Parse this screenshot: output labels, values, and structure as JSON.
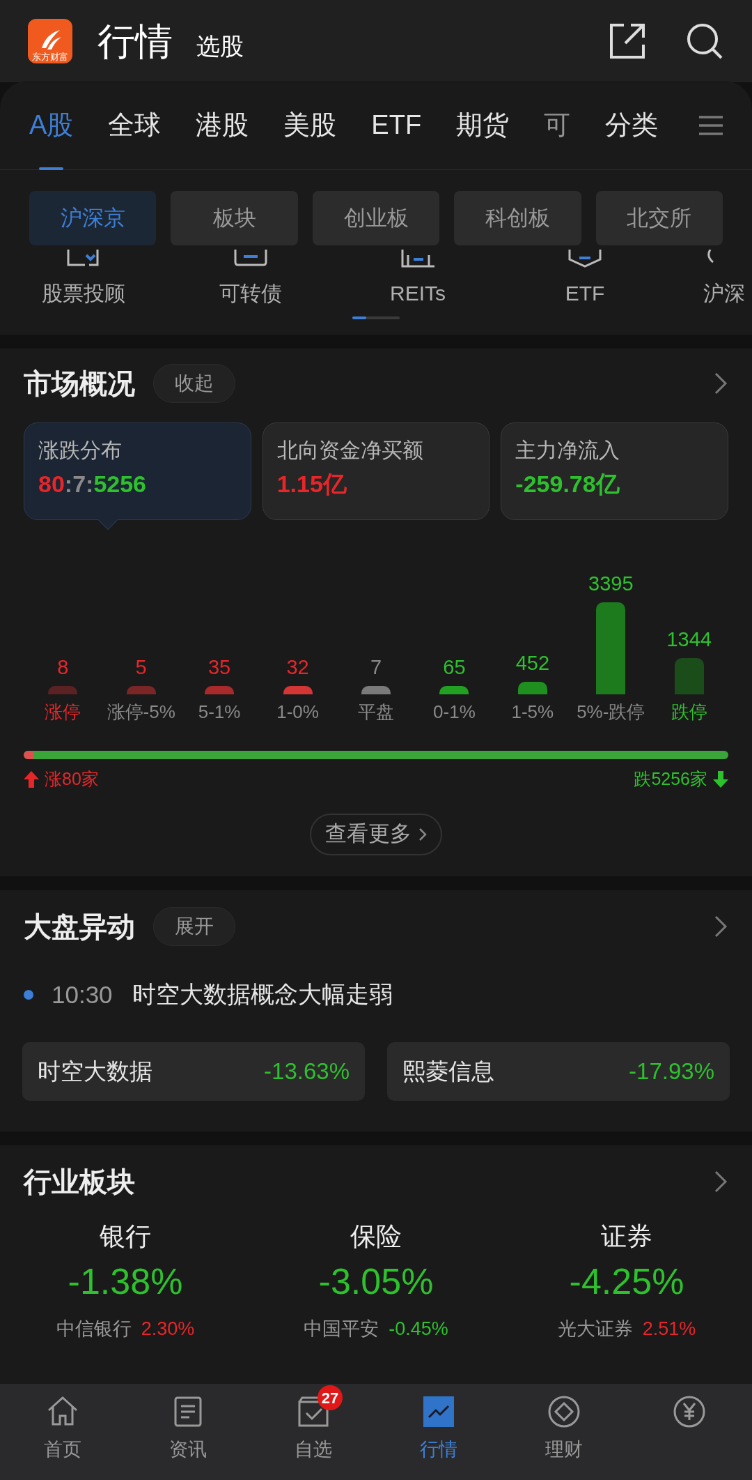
{
  "header": {
    "logo_text": "东方财富",
    "title": "行情",
    "subtitle": "选股"
  },
  "tabs": [
    {
      "label": "A股",
      "selected": true
    },
    {
      "label": "全球",
      "selected": false
    },
    {
      "label": "港股",
      "selected": false
    },
    {
      "label": "美股",
      "selected": false
    },
    {
      "label": "ETF",
      "selected": false
    },
    {
      "label": "期货",
      "selected": false
    },
    {
      "label": "可",
      "selected": false
    }
  ],
  "category_button": "分类",
  "sub_tabs": [
    {
      "label": "沪深京",
      "selected": true
    },
    {
      "label": "板块",
      "selected": false
    },
    {
      "label": "创业板",
      "selected": false
    },
    {
      "label": "科创板",
      "selected": false
    },
    {
      "label": "北交所",
      "selected": false
    }
  ],
  "shortcuts": [
    {
      "label": "股票投顾"
    },
    {
      "label": "可转债"
    },
    {
      "label": "REITs"
    },
    {
      "label": "ETF"
    },
    {
      "label": "沪深"
    }
  ],
  "market": {
    "title": "市场概况",
    "toggle": "收起",
    "cards": [
      {
        "label": "涨跌分布",
        "selected": true,
        "parts": [
          {
            "text": "80",
            "color": "#e8262a"
          },
          {
            "text": ":7:",
            "color": "#8a8a8a"
          },
          {
            "text": "5256",
            "color": "#2ec12e"
          }
        ]
      },
      {
        "label": "北向资金净买额",
        "selected": false,
        "parts": [
          {
            "text": "1.15亿",
            "color": "#e8262a"
          }
        ]
      },
      {
        "label": "主力净流入",
        "selected": false,
        "parts": [
          {
            "text": "-259.78亿",
            "color": "#2ec12e"
          }
        ]
      }
    ],
    "distribution": [
      {
        "category": "涨停",
        "count": "8",
        "kind": "up",
        "highlight": true,
        "color": "#5a2222"
      },
      {
        "category": "涨停-5%",
        "count": "5",
        "kind": "up",
        "highlight": false,
        "color": "#7a2626"
      },
      {
        "category": "5-1%",
        "count": "35",
        "kind": "up",
        "highlight": false,
        "color": "#a82a2a"
      },
      {
        "category": "1-0%",
        "count": "32",
        "kind": "up",
        "highlight": false,
        "color": "#d43535"
      },
      {
        "category": "平盘",
        "count": "7",
        "kind": "flat",
        "highlight": false,
        "color": "#7a7a7a"
      },
      {
        "category": "0-1%",
        "count": "65",
        "kind": "down",
        "highlight": false,
        "color": "#22a022"
      },
      {
        "category": "1-5%",
        "count": "452",
        "kind": "down",
        "highlight": false,
        "color": "#1f8f1f"
      },
      {
        "category": "5%-跌停",
        "count": "3395",
        "kind": "down",
        "highlight": false,
        "color": "#1d7a1d"
      },
      {
        "category": "跌停",
        "count": "1344",
        "kind": "down",
        "highlight": true,
        "color": "#1b4d1b"
      }
    ],
    "ratio": {
      "level": 0.015,
      "up_label": "涨80家",
      "down_label": "跌5256家"
    },
    "more_button": "查看更多"
  },
  "movers": {
    "title": "大盘异动",
    "toggle": "展开",
    "time": "10:30",
    "headline": "时空大数据概念大幅走弱",
    "stocks": [
      {
        "name": "时空大数据",
        "change": "-13.63%"
      },
      {
        "name": "熙菱信息",
        "change": "-17.93%"
      }
    ]
  },
  "sectors": {
    "title": "行业板块",
    "items": [
      {
        "name": "银行",
        "change": "-1.38%",
        "leader": "中信银行",
        "leader_change": "2.30%",
        "leader_up": true
      },
      {
        "name": "保险",
        "change": "-3.05%",
        "leader": "中国平安",
        "leader_change": "-0.45%",
        "leader_up": false
      },
      {
        "name": "证券",
        "change": "-4.25%",
        "leader": "光大证券",
        "leader_change": "2.51%",
        "leader_up": true
      }
    ]
  },
  "bottom_nav": [
    {
      "kind": "home",
      "label": "首页",
      "selected": false
    },
    {
      "kind": "news",
      "label": "资讯",
      "selected": false
    },
    {
      "kind": "watch",
      "label": "自选",
      "selected": false,
      "badge": "27"
    },
    {
      "kind": "chart",
      "label": "行情",
      "selected": true
    },
    {
      "kind": "wealth",
      "label": "理财",
      "selected": false
    },
    {
      "kind": "yen",
      "selected": false
    }
  ]
}
